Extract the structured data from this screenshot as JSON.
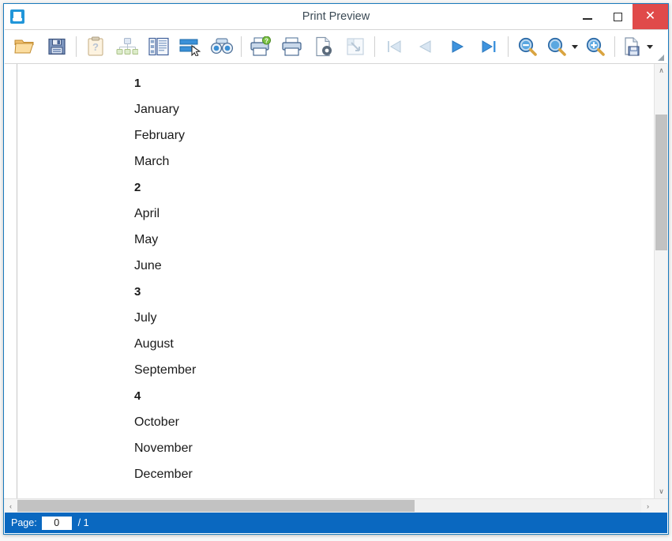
{
  "window": {
    "title": "Print Preview",
    "icon": "print-preview-icon",
    "controls": {
      "minimize": "–",
      "maximize": "□",
      "close": "✕",
      "close_color": "#e04a4a"
    },
    "border_color": "#1a7bbd"
  },
  "toolbar": {
    "items": [
      {
        "name": "open-icon",
        "label": "Open",
        "enabled": true
      },
      {
        "name": "save-icon",
        "label": "Save",
        "enabled": true
      },
      {
        "name": "document-map-icon",
        "label": "Document Map",
        "enabled": false
      },
      {
        "name": "thumbnails-icon",
        "label": "Thumbnails",
        "enabled": false
      },
      {
        "name": "parameters-icon",
        "label": "Parameters",
        "enabled": true
      },
      {
        "name": "editing-fields-icon",
        "label": "Editing Fields",
        "enabled": true
      },
      {
        "name": "find-icon",
        "label": "Find",
        "enabled": true
      },
      {
        "name": "quick-print-icon",
        "label": "Quick Print",
        "enabled": true
      },
      {
        "name": "print-icon",
        "label": "Print",
        "enabled": true
      },
      {
        "name": "page-setup-icon",
        "label": "Page Setup",
        "enabled": true
      },
      {
        "name": "scale-icon",
        "label": "Scale",
        "enabled": false
      },
      {
        "name": "first-page-icon",
        "label": "First Page",
        "enabled": false
      },
      {
        "name": "previous-page-icon",
        "label": "Previous Page",
        "enabled": false
      },
      {
        "name": "next-page-icon",
        "label": "Next Page",
        "enabled": true
      },
      {
        "name": "last-page-icon",
        "label": "Last Page",
        "enabled": true
      },
      {
        "name": "zoom-out-icon",
        "label": "Zoom Out",
        "enabled": true
      },
      {
        "name": "zoom-icon",
        "label": "Zoom",
        "enabled": true
      },
      {
        "name": "zoom-in-icon",
        "label": "Zoom In",
        "enabled": true
      },
      {
        "name": "export-icon",
        "label": "Export To",
        "enabled": true
      }
    ]
  },
  "preview": {
    "lines": [
      {
        "text": "1",
        "type": "group"
      },
      {
        "text": "January",
        "type": "item"
      },
      {
        "text": "February",
        "type": "item"
      },
      {
        "text": "March",
        "type": "item"
      },
      {
        "text": "2",
        "type": "group"
      },
      {
        "text": "April",
        "type": "item"
      },
      {
        "text": "May",
        "type": "item"
      },
      {
        "text": "June",
        "type": "item"
      },
      {
        "text": "3",
        "type": "group"
      },
      {
        "text": "July",
        "type": "item"
      },
      {
        "text": "August",
        "type": "item"
      },
      {
        "text": "September",
        "type": "item"
      },
      {
        "text": "4",
        "type": "group"
      },
      {
        "text": "October",
        "type": "item"
      },
      {
        "text": "November",
        "type": "item"
      },
      {
        "text": "December",
        "type": "item"
      }
    ]
  },
  "scrollbars": {
    "vertical": {
      "up_arrow": "∧",
      "down_arrow": "∨"
    },
    "horizontal": {
      "left_arrow": "‹",
      "right_arrow": "›"
    }
  },
  "statusbar": {
    "page_label": "Page:",
    "page_value": "0",
    "page_total": "/ 1",
    "background": "#0a68c0"
  }
}
